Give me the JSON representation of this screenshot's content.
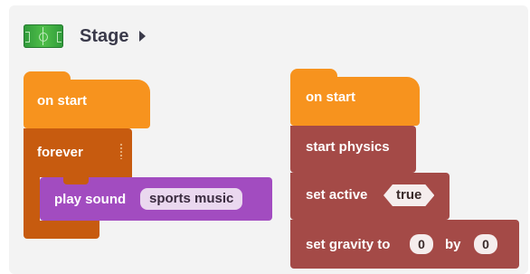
{
  "stage": {
    "title": "Stage",
    "thumbnail_icon": "soccer-field-icon",
    "expand_icon": "caret-right-icon"
  },
  "left_script": {
    "on_start_label": "on start",
    "forever_label": "forever",
    "play_sound_label": "play sound",
    "sound_value": "sports music"
  },
  "right_script": {
    "on_start_label": "on start",
    "start_physics_label": "start physics",
    "set_active_label": "set active",
    "active_value": "true",
    "set_gravity_label": "set gravity to",
    "gravity_x": "0",
    "by_label": "by",
    "gravity_y": "0"
  },
  "colors": {
    "events": "#f7931e",
    "loops": "#c75b0f",
    "sound": "#a24cc0",
    "physics": "#a44a47"
  }
}
